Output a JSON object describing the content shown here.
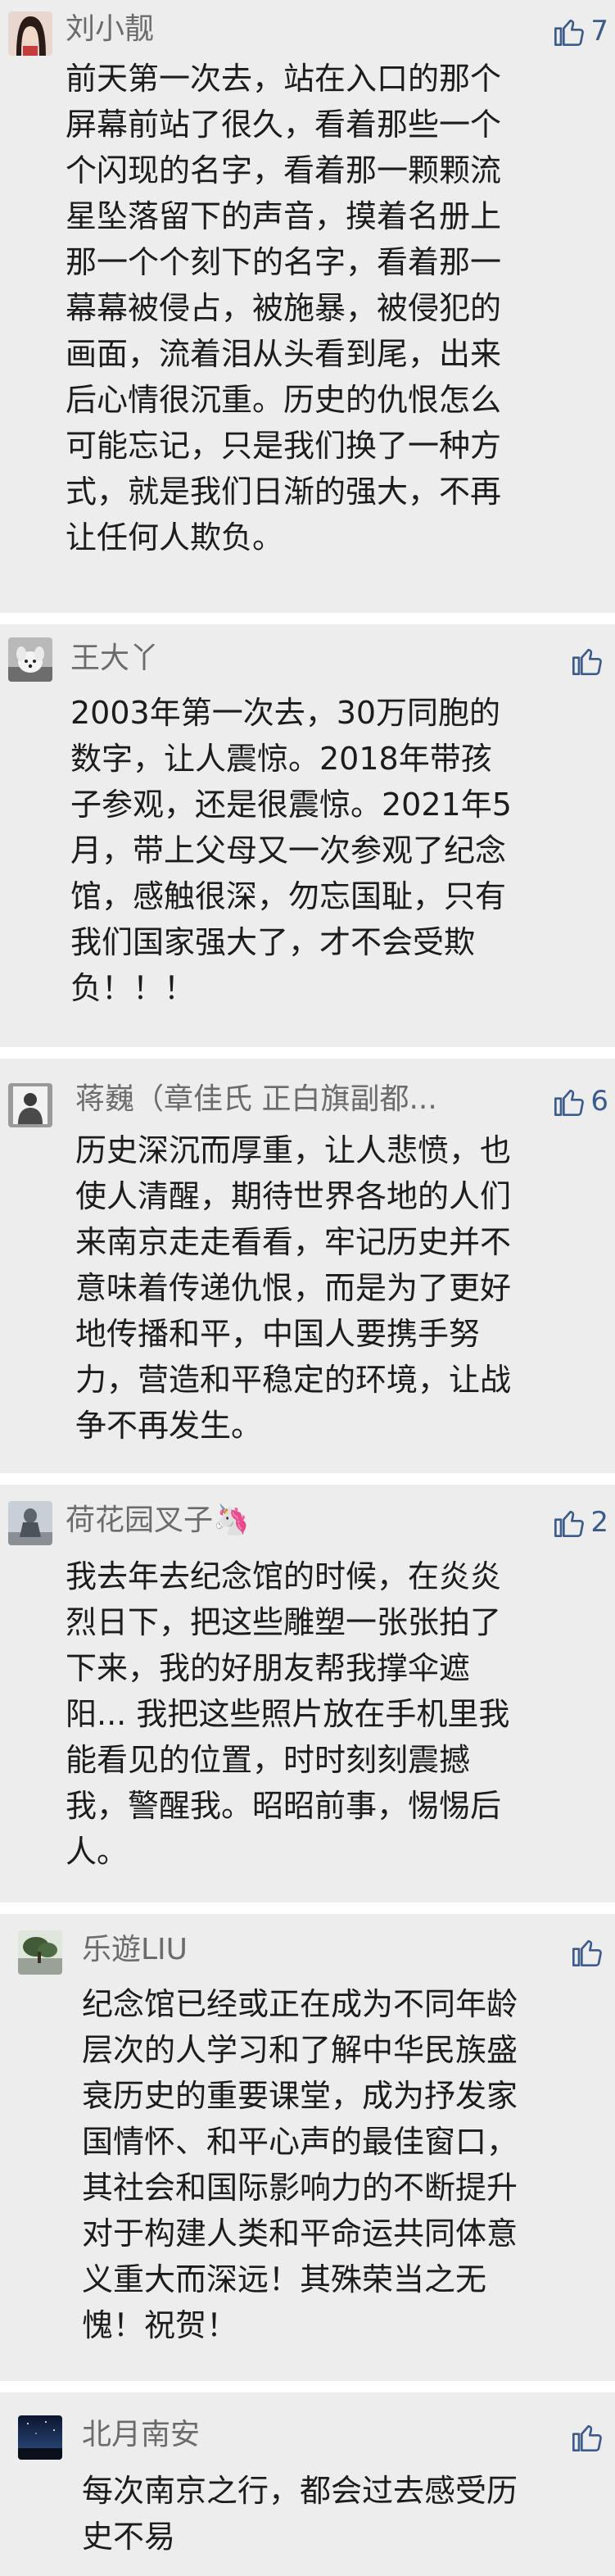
{
  "comments": [
    {
      "user": "刘小靓",
      "avatar": "woman-avatar",
      "likes": "7",
      "text": "前天第一次去，站在入口的那个\n屏幕前站了很久，看着那些一个\n个闪现的名字，看着那一颗颗流\n星坠落留下的声音，摸着名册上\n那一个个刻下的名字，看着那一\n幕幕被侵占，被施暴，被侵犯的\n画面，流着泪从头看到尾，出来\n后心情很沉重。历史的仇恨怎么\n可能忘记，只是我们换了一种方\n式，就是我们日渐的强大，不再\n让任何人欺负。"
    },
    {
      "user": "王大丫",
      "avatar": "dog-avatar",
      "likes": "",
      "text": "2003年第一次去，30万同胞的\n数字，让人震惊。2018年带孩\n子参观，还是很震惊。2021年5\n月，带上父母又一次参观了纪念\n馆，感触很深，勿忘国耻，只有\n我们国家强大了，才不会受欺\n负！！！"
    },
    {
      "user": "蒋巍（章佳氏 正白旗副都...",
      "avatar": "portrait-avatar",
      "likes": "6",
      "text": "历史深沉而厚重，让人悲愤，也\n使人清醒，期待世界各地的人们\n来南京走走看看，牢记历史并不\n意味着传递仇恨，而是为了更好\n地传播和平，中国人要携手努\n力，营造和平稳定的环境，让战\n争不再发生。"
    },
    {
      "user": "荷花园叉子🦄",
      "avatar": "statue-avatar",
      "likes": "2",
      "text": "我去年去纪念馆的时候，在炎炎\n烈日下，把这些雕塑一张张拍了\n下来，我的好朋友帮我撑伞遮\n阳... 我把这些照片放在手机里我\n能看见的位置，时时刻刻震撼\n我，警醒我。昭昭前事，惕惕后\n人。"
    },
    {
      "user": "乐遊LIU",
      "avatar": "tree-avatar",
      "likes": "",
      "text": "纪念馆已经或正在成为不同年龄\n层次的人学习和了解中华民族盛\n衰历史的重要课堂，成为抒发家\n国情怀、和平心声的最佳窗口，\n其社会和国际影响力的不断提升\n对于构建人类和平命运共同体意\n义重大而深远！其殊荣当之无\n愧！祝贺！"
    },
    {
      "user": "北月南安",
      "avatar": "night-sky-avatar",
      "likes": "",
      "text": "每次南京之行，都会过去感受历\n史不易"
    }
  ],
  "colors": {
    "card_bg": "#ededed",
    "name": "#6b6b6b",
    "text": "#1c1c1c",
    "like_icon": "#3b5b8a"
  }
}
